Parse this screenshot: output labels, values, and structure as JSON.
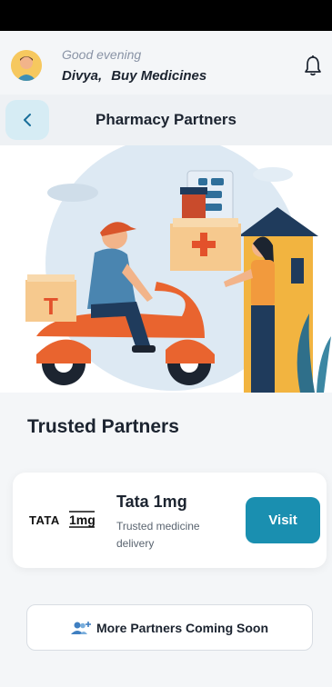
{
  "greeting": {
    "salutation": "Good evening",
    "name": "Divya,",
    "action": "Buy Medicines"
  },
  "header": {
    "title": "Pharmacy Partners"
  },
  "section": {
    "title": "Trusted Partners"
  },
  "partners": [
    {
      "logo": "TATA 1mg",
      "name": "Tata 1mg",
      "description": "Trusted medicine delivery",
      "cta": "Visit"
    }
  ],
  "more_partners": {
    "label": "More Partners Coming Soon",
    "icon": "add-user-icon"
  },
  "colors": {
    "accent": "#1a8fb0",
    "background": "#f4f6f8",
    "card": "#ffffff"
  }
}
